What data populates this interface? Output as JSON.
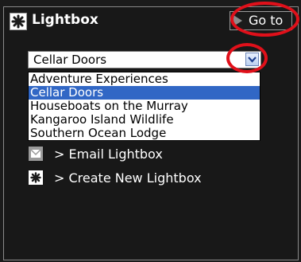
{
  "header": {
    "title": "Lightbox",
    "icon": "asterisk-icon"
  },
  "goto_button": {
    "label": "Go to",
    "icon": "play-arrow-icon"
  },
  "lightbox_select": {
    "selected": "Cellar Doors",
    "options": [
      "Adventure Experiences",
      "Cellar Doors",
      "Houseboats on the Murray",
      "Kangaroo Island Wildlife",
      "Southern Ocean Lodge"
    ],
    "selected_index": 1
  },
  "actions": {
    "email_label": "> Email Lightbox",
    "email_icon": "envelope-icon",
    "create_label": "> Create New Lightbox",
    "create_icon": "asterisk-icon"
  },
  "colors": {
    "panel_background": "#1b1b1b",
    "highlight_ring": "#e0101a",
    "selected_option": "#3167c5"
  }
}
